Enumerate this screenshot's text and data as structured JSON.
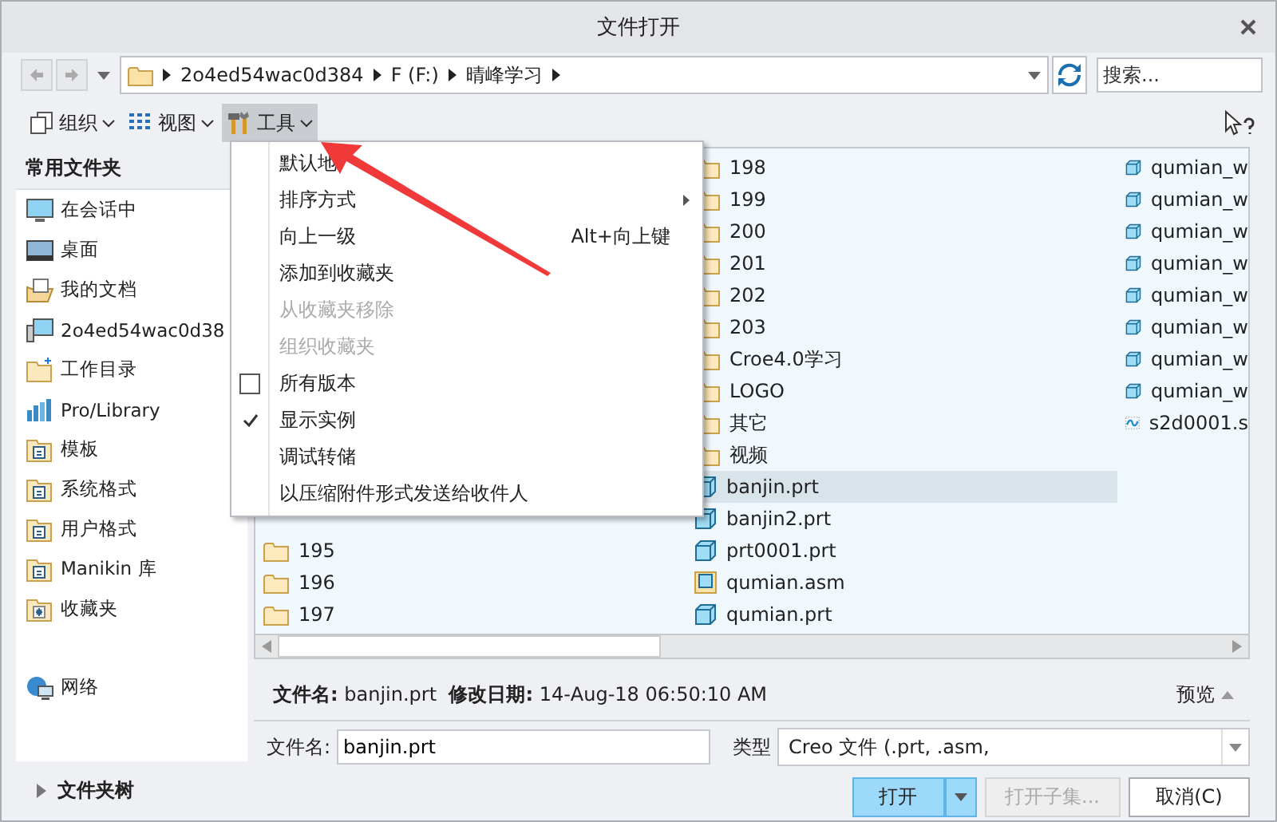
{
  "window": {
    "title": "文件打开"
  },
  "address": {
    "crumbs": [
      "2o4ed54wac0d384",
      "F (F:)",
      "晴峰学习"
    ]
  },
  "search": {
    "placeholder": "搜索..."
  },
  "toolbar": [
    {
      "label": "组织",
      "kind": "organize",
      "selected": false
    },
    {
      "label": "视图",
      "kind": "view",
      "selected": false
    },
    {
      "label": "工具",
      "kind": "tools",
      "selected": true
    }
  ],
  "sidebar": {
    "title": "常用文件夹",
    "items": [
      {
        "label": "在会话中",
        "kind": "monitor"
      },
      {
        "label": "桌面",
        "kind": "desktop"
      },
      {
        "label": "我的文档",
        "kind": "docs"
      },
      {
        "label": "2o4ed54wac0d38",
        "kind": "computer"
      },
      {
        "label": "工作目录",
        "kind": "workdir"
      },
      {
        "label": "Pro/Library",
        "kind": "library"
      },
      {
        "label": "模板",
        "kind": "template"
      },
      {
        "label": "系统格式",
        "kind": "template"
      },
      {
        "label": "用户格式",
        "kind": "template"
      },
      {
        "label": "Manikin 库",
        "kind": "template"
      },
      {
        "label": "收藏夹",
        "kind": "favorites"
      }
    ],
    "network": {
      "label": "网络"
    },
    "tree_toggle": {
      "label": "文件夹树",
      "expanded": false
    }
  },
  "files": {
    "columns": [
      [
        {
          "name": "195",
          "kind": "folder",
          "selected": false
        },
        {
          "name": "196",
          "kind": "folder",
          "selected": false
        },
        {
          "name": "197",
          "kind": "folder",
          "selected": false
        }
      ],
      [
        {
          "name": "198",
          "kind": "folder",
          "selected": false
        },
        {
          "name": "199",
          "kind": "folder",
          "selected": false
        },
        {
          "name": "200",
          "kind": "folder",
          "selected": false
        },
        {
          "name": "201",
          "kind": "folder",
          "selected": false
        },
        {
          "name": "202",
          "kind": "folder",
          "selected": false
        },
        {
          "name": "203",
          "kind": "folder",
          "selected": false
        },
        {
          "name": "Croe4.0学习",
          "kind": "folder",
          "selected": false
        },
        {
          "name": "LOGO",
          "kind": "folder",
          "selected": false
        },
        {
          "name": "其它",
          "kind": "folder",
          "selected": false
        },
        {
          "name": "视频",
          "kind": "folder",
          "selected": false
        },
        {
          "name": "banjin.prt",
          "kind": "part",
          "selected": true
        },
        {
          "name": "banjin2.prt",
          "kind": "part",
          "selected": false
        },
        {
          "name": "prt0001.prt",
          "kind": "part",
          "selected": false
        },
        {
          "name": "qumian.asm",
          "kind": "assembly",
          "selected": false
        },
        {
          "name": "qumian.prt",
          "kind": "part",
          "selected": false
        }
      ],
      [
        {
          "name": "qumian_w",
          "kind": "part",
          "selected": false
        },
        {
          "name": "qumian_w",
          "kind": "part",
          "selected": false
        },
        {
          "name": "qumian_w",
          "kind": "part",
          "selected": false
        },
        {
          "name": "qumian_w",
          "kind": "part",
          "selected": false
        },
        {
          "name": "qumian_w",
          "kind": "part",
          "selected": false
        },
        {
          "name": "qumian_w",
          "kind": "part",
          "selected": false
        },
        {
          "name": "qumian_w",
          "kind": "part",
          "selected": false
        },
        {
          "name": "qumian_w",
          "kind": "part",
          "selected": false
        },
        {
          "name": "s2d0001.s",
          "kind": "drawing",
          "selected": false
        }
      ]
    ]
  },
  "menu": {
    "items": [
      {
        "label": "默认地",
        "kind": "plain",
        "disabled": false
      },
      {
        "label": "排序方式",
        "kind": "submenu",
        "disabled": false
      },
      {
        "label": "向上一级",
        "kind": "plain",
        "shortcut": "Alt+向上键",
        "disabled": false
      },
      {
        "label": "添加到收藏夹",
        "kind": "plain",
        "disabled": false
      },
      {
        "label": "从收藏夹移除",
        "kind": "plain",
        "disabled": true
      },
      {
        "label": "组织收藏夹",
        "kind": "plain",
        "disabled": true
      },
      {
        "label": "所有版本",
        "kind": "check",
        "checked": false,
        "disabled": false
      },
      {
        "label": "显示实例",
        "kind": "check",
        "checked": true,
        "disabled": false
      },
      {
        "label": "调试转储",
        "kind": "plain",
        "disabled": false
      },
      {
        "label": "以压缩附件形式发送给收件人",
        "kind": "plain",
        "disabled": false
      }
    ]
  },
  "info": {
    "name_label": "文件名:",
    "name": "banjin.prt",
    "date_label": "修改日期:",
    "date": "14-Aug-18 06:50:10 AM",
    "preview": "预览"
  },
  "filename_field": {
    "label": "文件名:",
    "value": "banjin.prt"
  },
  "type_field": {
    "label": "类型",
    "value": "Creo 文件 (.prt, .asm,"
  },
  "buttons": [
    {
      "label": "打开",
      "kind": "split",
      "disabled": false
    },
    {
      "label": "打开子集...",
      "kind": "plain",
      "disabled": true
    },
    {
      "label": "取消(C)",
      "kind": "plain",
      "disabled": false
    }
  ]
}
